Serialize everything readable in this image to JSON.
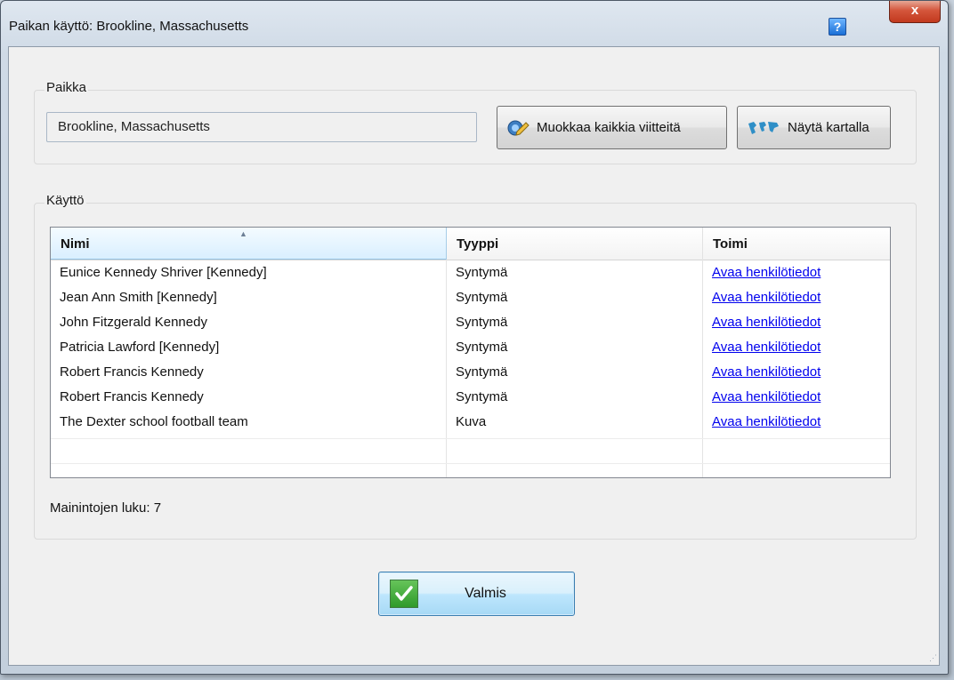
{
  "window": {
    "title": "Paikan käyttö: Brookline, Massachusetts",
    "help_label": "?",
    "close_label": "x"
  },
  "place_group": {
    "legend": "Paikka",
    "place_value": "Brookline, Massachusetts",
    "edit_button_label": "Muokkaa kaikkia viitteitä",
    "map_button_label": "Näytä kartalla"
  },
  "usage_group": {
    "legend": "Käyttö",
    "table": {
      "columns": [
        "Nimi",
        "Tyyppi",
        "Toimi"
      ],
      "sorted_column": "Nimi",
      "rows": [
        {
          "name": "Eunice Kennedy Shriver [Kennedy]",
          "type": "Syntymä",
          "action": "Avaa henkilötiedot"
        },
        {
          "name": "Jean Ann Smith [Kennedy]",
          "type": "Syntymä",
          "action": "Avaa henkilötiedot"
        },
        {
          "name": "John Fitzgerald Kennedy",
          "type": "Syntymä",
          "action": "Avaa henkilötiedot"
        },
        {
          "name": "Patricia Lawford [Kennedy]",
          "type": "Syntymä",
          "action": "Avaa henkilötiedot"
        },
        {
          "name": "Robert Francis Kennedy",
          "type": "Syntymä",
          "action": "Avaa henkilötiedot"
        },
        {
          "name": "Robert Francis Kennedy",
          "type": "Syntymä",
          "action": "Avaa henkilötiedot"
        },
        {
          "name": "The Dexter school football team",
          "type": "Kuva",
          "action": "Avaa henkilötiedot"
        }
      ]
    },
    "count_label": "Mainintojen luku: 7"
  },
  "footer": {
    "done_label": "Valmis"
  }
}
